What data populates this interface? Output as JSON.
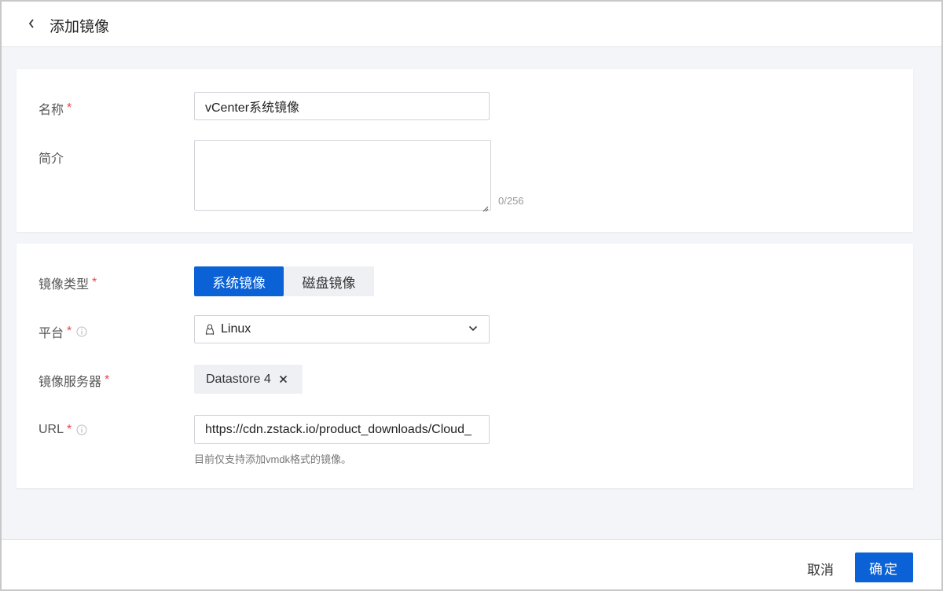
{
  "header": {
    "title": "添加镜像"
  },
  "form": {
    "name": {
      "label": "名称",
      "required": "*",
      "value": "vCenter系统镜像"
    },
    "description": {
      "label": "简介",
      "value": "",
      "counter": "0/256"
    },
    "image_type": {
      "label": "镜像类型",
      "required": "*",
      "options": [
        "系统镜像",
        "磁盘镜像"
      ],
      "selected": "系统镜像"
    },
    "platform": {
      "label": "平台",
      "required": "*",
      "value": "Linux",
      "icon": "linux-penguin-icon"
    },
    "image_server": {
      "label": "镜像服务器",
      "required": "*",
      "tag": "Datastore 4"
    },
    "url": {
      "label": "URL",
      "required": "*",
      "value": "https://cdn.zstack.io/product_downloads/Cloud_",
      "hint": "目前仅支持添加vmdk格式的镜像。"
    }
  },
  "footer": {
    "cancel_label": "取消",
    "ok_label": "确定"
  },
  "colors": {
    "primary": "#0b62d6",
    "required": "#e5484d",
    "page_bg": "#f4f5f8"
  }
}
